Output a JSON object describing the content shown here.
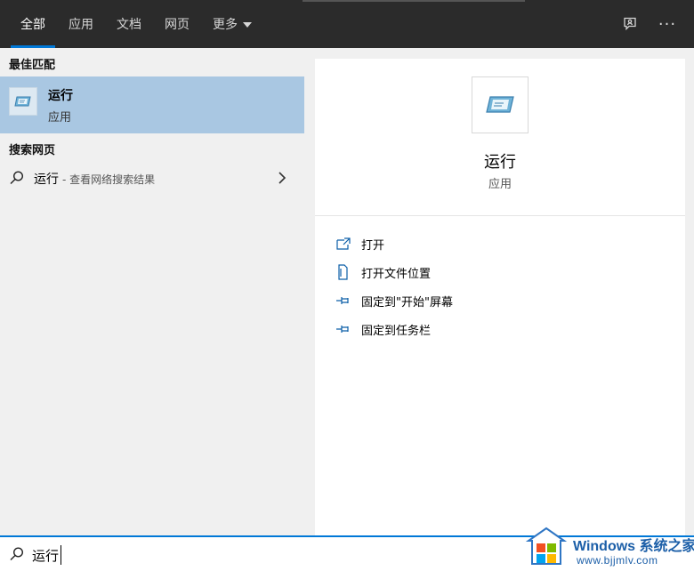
{
  "tabs": [
    {
      "label": "全部",
      "active": true
    },
    {
      "label": "应用",
      "active": false
    },
    {
      "label": "文档",
      "active": false
    },
    {
      "label": "网页",
      "active": false
    },
    {
      "label": "更多",
      "active": false
    }
  ],
  "header_icons": {
    "feedback": "feedback-icon",
    "more": "more-options-icon",
    "more_glyph": "···"
  },
  "results": {
    "best_match_header": "最佳匹配",
    "best_match": {
      "title": "运行",
      "subtitle": "应用",
      "icon": "run-app-icon"
    },
    "web_header": "搜索网页",
    "web_result": {
      "query": "运行",
      "hint": "- 查看网络搜索结果",
      "icon": "search-icon"
    }
  },
  "preview": {
    "title": "运行",
    "subtitle": "应用",
    "actions": [
      {
        "label": "打开",
        "icon": "open-icon"
      },
      {
        "label": "打开文件位置",
        "icon": "file-location-icon"
      },
      {
        "label": "固定到\"开始\"屏幕",
        "icon": "pin-icon"
      },
      {
        "label": "固定到任务栏",
        "icon": "pin-icon"
      }
    ]
  },
  "search": {
    "value": "运行"
  },
  "watermark": {
    "brand": "Windows 系统之家",
    "url": "www.bjjmlv.com"
  },
  "colors": {
    "accent": "#0078d7",
    "selection": "#a9c7e2",
    "topbar": "#2b2b2b"
  }
}
